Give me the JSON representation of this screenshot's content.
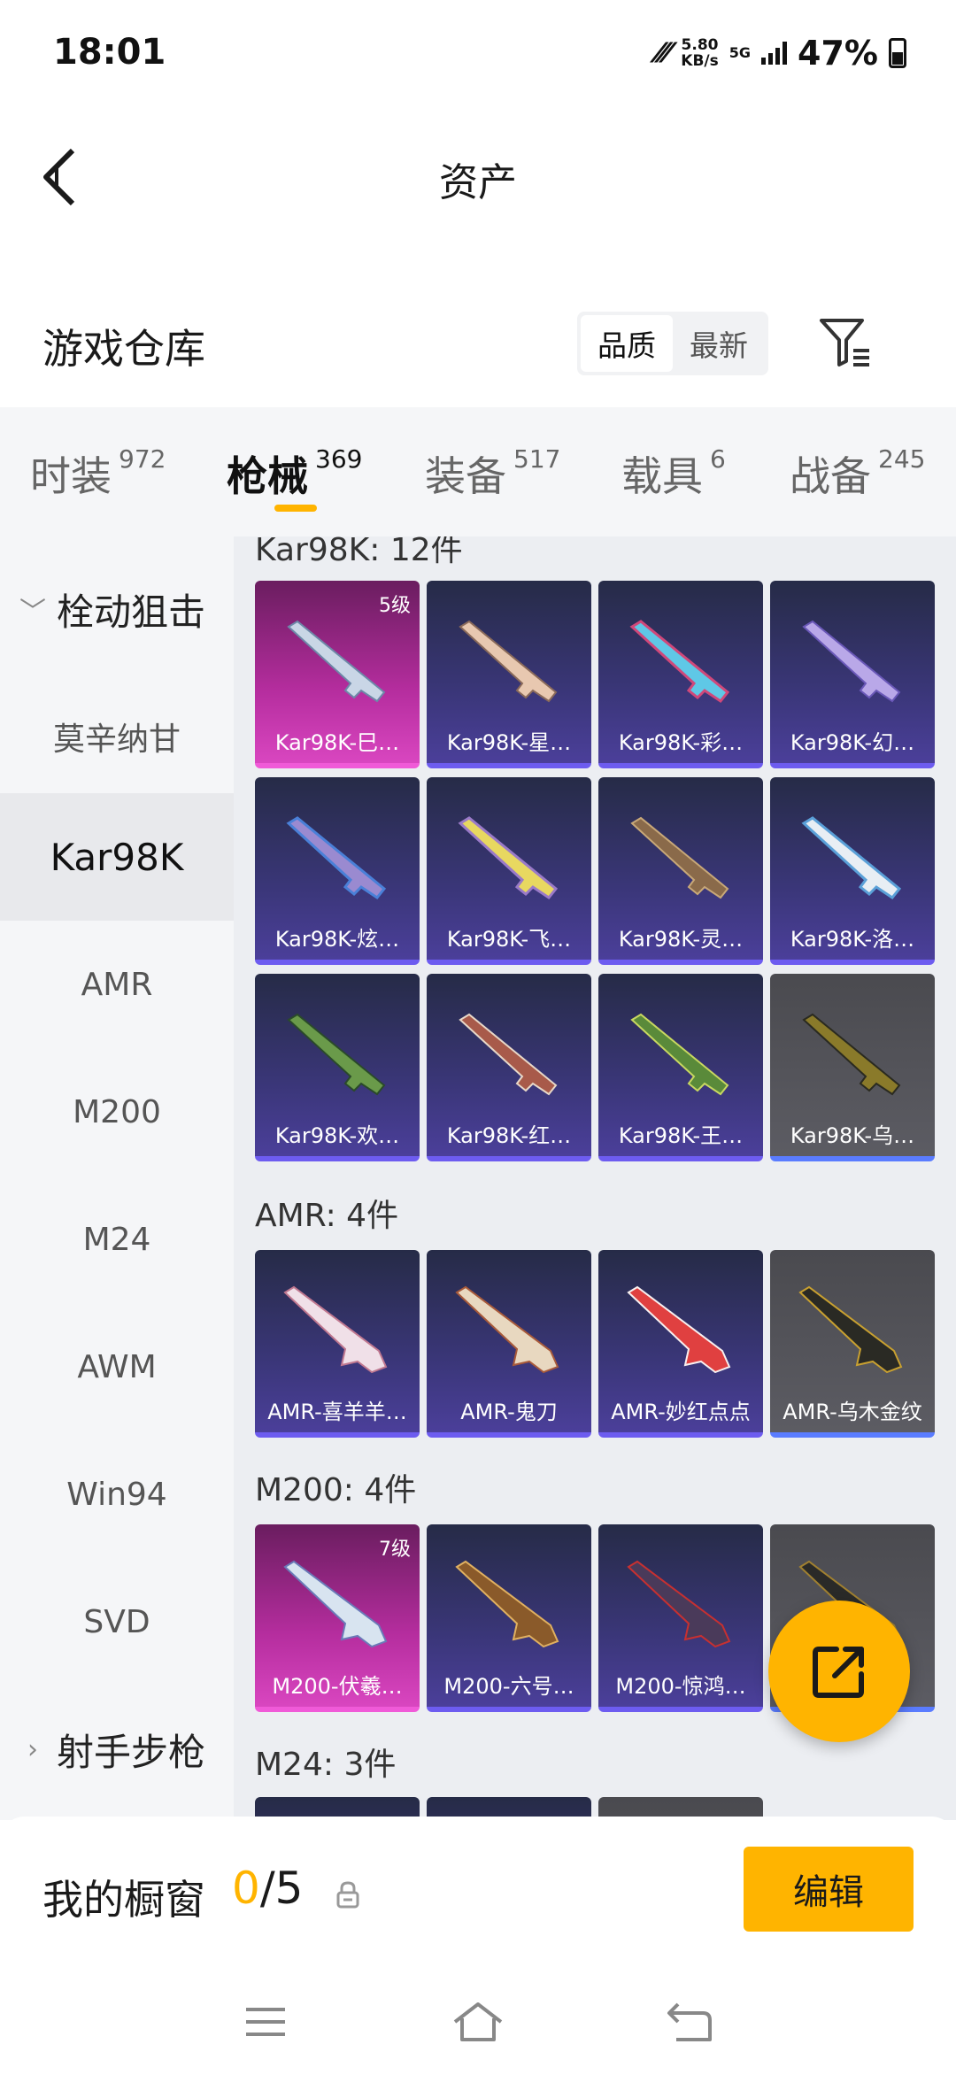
{
  "status": {
    "time": "18:01",
    "speed_value": "5.80",
    "speed_unit": "KB/s",
    "network": "5G",
    "battery": "47%"
  },
  "header": {
    "title": "资产"
  },
  "warehouse": {
    "title": "游戏仓库",
    "sort_quality": "品质",
    "sort_newest": "最新"
  },
  "tabs": [
    {
      "label": "时装",
      "count": "972"
    },
    {
      "label": "枪械",
      "count": "369"
    },
    {
      "label": "装备",
      "count": "517"
    },
    {
      "label": "载具",
      "count": "6"
    },
    {
      "label": "战备",
      "count": "245"
    }
  ],
  "sidebar": {
    "group1": "栓动狙击",
    "items": [
      "莫辛纳甘",
      "Kar98K",
      "AMR",
      "M200",
      "M24",
      "AWM",
      "Win94",
      "SVD"
    ],
    "group2": "射手步枪"
  },
  "sections": {
    "kar98k": "Kar98K: 12件",
    "amr": "AMR: 4件",
    "m200": "M200: 4件",
    "m24": "M24: 3件"
  },
  "cards": {
    "kar": [
      {
        "name": "Kar98K-巳…",
        "level": "5级"
      },
      {
        "name": "Kar98K-星…"
      },
      {
        "name": "Kar98K-彩…"
      },
      {
        "name": "Kar98K-幻…"
      },
      {
        "name": "Kar98K-炫…"
      },
      {
        "name": "Kar98K-飞…"
      },
      {
        "name": "Kar98K-灵…"
      },
      {
        "name": "Kar98K-洛…"
      },
      {
        "name": "Kar98K-欢…"
      },
      {
        "name": "Kar98K-红…"
      },
      {
        "name": "Kar98K-王…"
      },
      {
        "name": "Kar98K-乌…"
      }
    ],
    "amr": [
      {
        "name": "AMR-喜羊羊…"
      },
      {
        "name": "AMR-鬼刀"
      },
      {
        "name": "AMR-妙红点点"
      },
      {
        "name": "AMR-乌木金纹"
      }
    ],
    "m200": [
      {
        "name": "M200-伏羲…",
        "level": "7级"
      },
      {
        "name": "M200-六号…"
      },
      {
        "name": "M200-惊鸿…"
      },
      {
        "name": "…"
      }
    ]
  },
  "showcase": {
    "title": "我的橱窗",
    "used": "0",
    "total": "/5",
    "edit": "编辑"
  },
  "colors": {
    "accent": "#ffb400",
    "pink_rarity": "#d946c0",
    "purple_rarity": "#4b3f9a",
    "grey_rarity": "#5c5c63"
  }
}
